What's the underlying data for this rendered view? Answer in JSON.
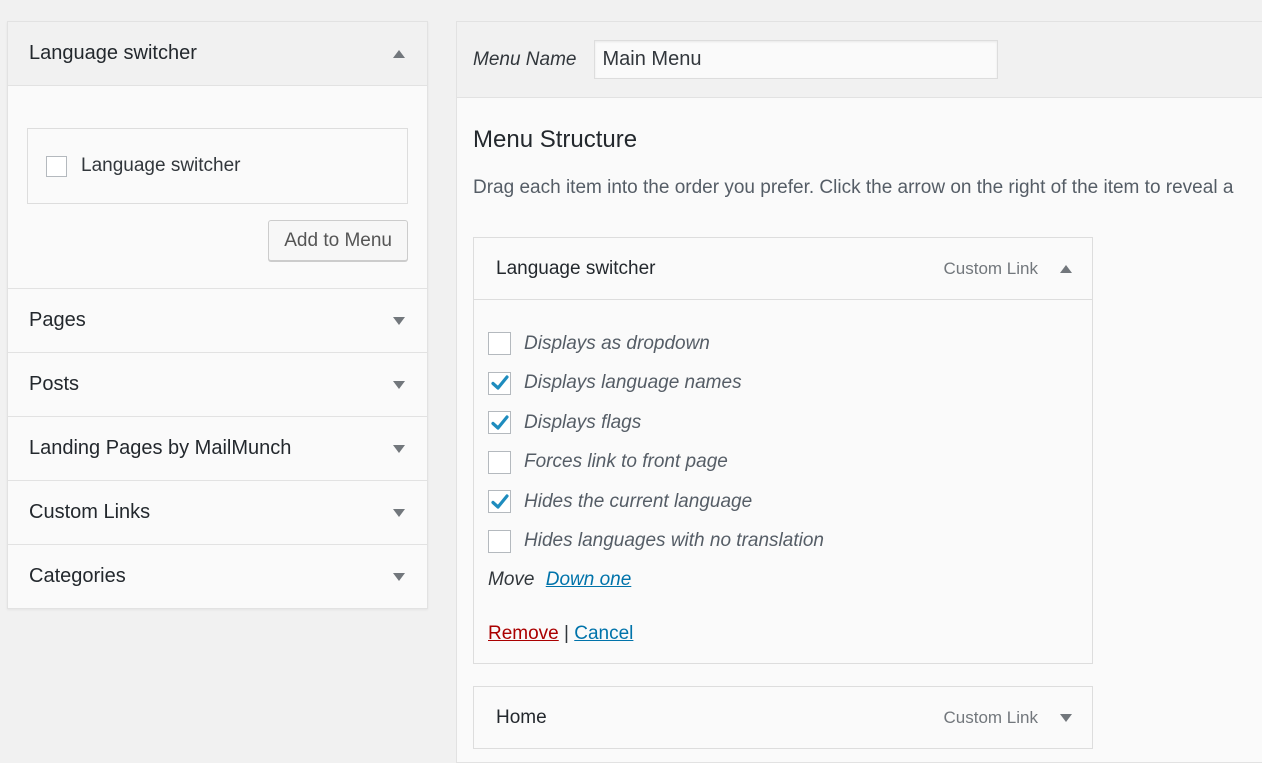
{
  "left_panel": {
    "sections": [
      {
        "title": "Language switcher",
        "expanded": true
      },
      {
        "title": "Pages",
        "expanded": false
      },
      {
        "title": "Posts",
        "expanded": false
      },
      {
        "title": "Landing Pages by MailMunch",
        "expanded": false
      },
      {
        "title": "Custom Links",
        "expanded": false
      },
      {
        "title": "Categories",
        "expanded": false
      }
    ],
    "language_switcher": {
      "checkbox_label": "Language switcher",
      "checked": false,
      "add_button": "Add to Menu"
    }
  },
  "menu": {
    "name_label": "Menu Name",
    "name_value": "Main Menu",
    "structure_title": "Menu Structure",
    "structure_desc": "Drag each item into the order you prefer. Click the arrow on the right of the item to reveal a",
    "items": [
      {
        "title": "Language switcher",
        "type": "Custom Link",
        "expanded": true,
        "options": [
          {
            "label": "Displays as dropdown",
            "checked": false
          },
          {
            "label": "Displays language names",
            "checked": true
          },
          {
            "label": "Displays flags",
            "checked": true
          },
          {
            "label": "Forces link to front page",
            "checked": false
          },
          {
            "label": "Hides the current language",
            "checked": true
          },
          {
            "label": "Hides languages with no translation",
            "checked": false
          }
        ],
        "move_label": "Move",
        "move_link": "Down one",
        "remove_label": "Remove",
        "separator": "|",
        "cancel_label": "Cancel"
      },
      {
        "title": "Home",
        "type": "Custom Link",
        "expanded": false
      }
    ]
  },
  "colors": {
    "accent": "#0073aa",
    "danger": "#aa0000",
    "checkmark": "#1e8cbe"
  }
}
